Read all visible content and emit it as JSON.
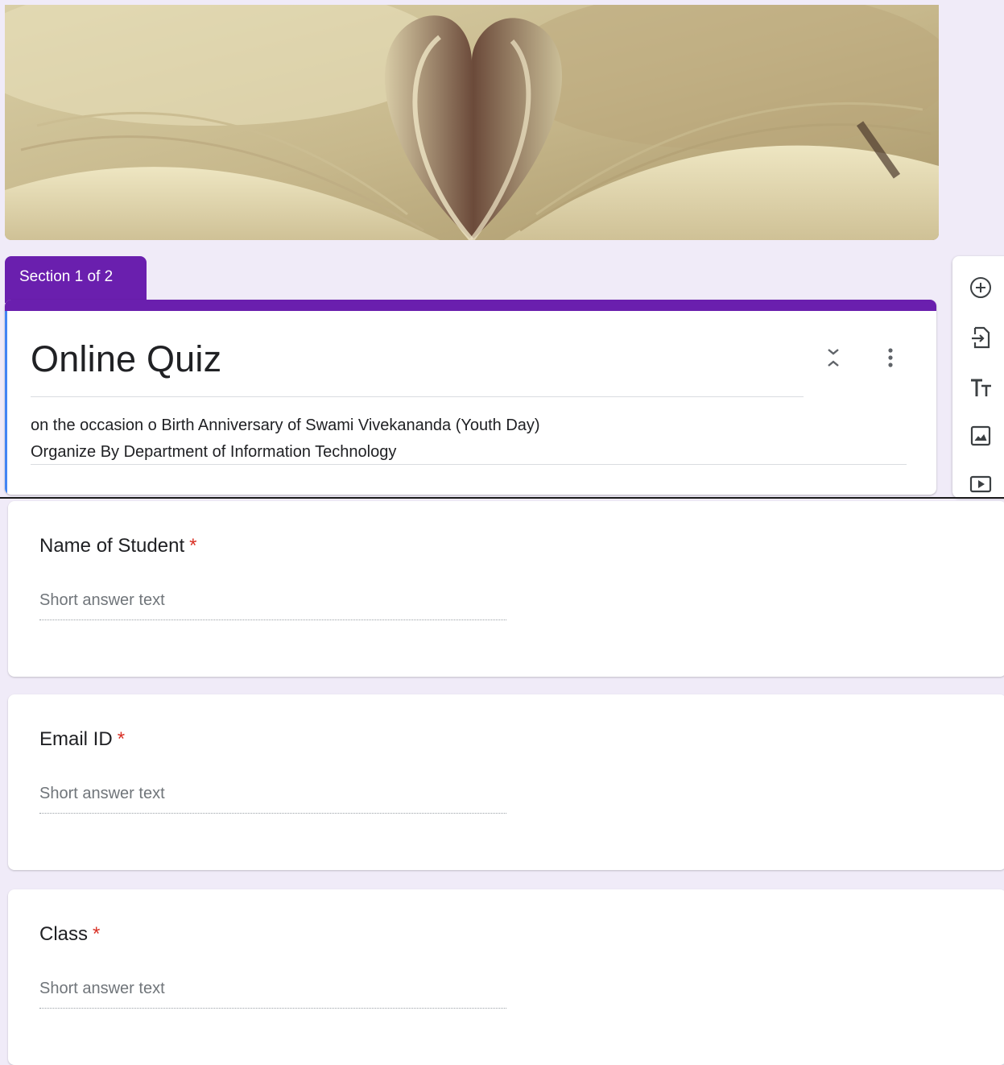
{
  "section": {
    "tab_label": "Section 1 of 2"
  },
  "form": {
    "title": "Online Quiz",
    "description_line1": "on the occasion o Birth Anniversary of Swami Vivekananda (Youth Day)",
    "description_line2": "Organize By Department of Information Technology"
  },
  "icons": {
    "collapse": "collapse-icon",
    "more": "more-vert-icon",
    "add_question": "add-circle-icon",
    "import_questions": "import-icon",
    "add_title": "title-text-icon",
    "add_image": "image-icon",
    "add_video": "video-icon"
  },
  "questions": [
    {
      "label": "Name of Student",
      "required_mark": "*",
      "placeholder": "Short answer text"
    },
    {
      "label": "Email ID",
      "required_mark": "*",
      "placeholder": "Short answer text"
    },
    {
      "label": "Class",
      "required_mark": "*",
      "placeholder": "Short answer text"
    }
  ],
  "colors": {
    "accent": "#6a1fae",
    "background": "#f0ebf8",
    "required": "#d93025",
    "focus_bar": "#4285f4"
  }
}
